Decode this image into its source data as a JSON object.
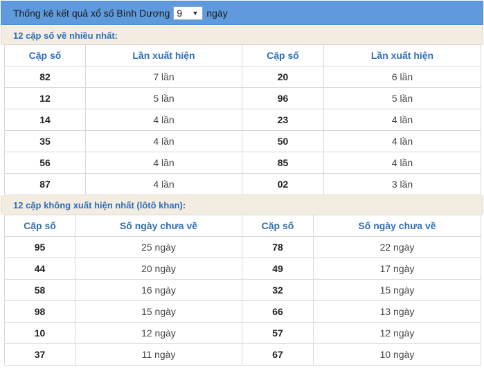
{
  "header": {
    "title": "Thống kê kết quả xổ số Bình Dương",
    "select_value": "9",
    "suffix": "ngày"
  },
  "most": {
    "label": "12 cặp số về nhiều nhất:",
    "columns": [
      "Cặp số",
      "Lần xuất hiện",
      "Cặp số",
      "Lần xuất hiện"
    ],
    "rows": [
      [
        "82",
        "7 lần",
        "20",
        "6 lần"
      ],
      [
        "12",
        "5 lần",
        "96",
        "5 lần"
      ],
      [
        "14",
        "4 lần",
        "23",
        "4 lần"
      ],
      [
        "35",
        "4 lần",
        "50",
        "4 lần"
      ],
      [
        "56",
        "4 lần",
        "85",
        "4 lần"
      ],
      [
        "87",
        "4 lần",
        "02",
        "3 lần"
      ]
    ]
  },
  "absent": {
    "label": "12 cặp không xuất hiện nhất (lôtô khan):",
    "columns": [
      "Cặp số",
      "Số ngày chưa về",
      "Cặp số",
      "Số ngày chưa về"
    ],
    "rows": [
      [
        "95",
        "25 ngày",
        "78",
        "22 ngày"
      ],
      [
        "44",
        "20 ngày",
        "49",
        "17 ngày"
      ],
      [
        "58",
        "16 ngày",
        "32",
        "15 ngày"
      ],
      [
        "98",
        "15 ngày",
        "66",
        "13 ngày"
      ],
      [
        "10",
        "12 ngày",
        "57",
        "12 ngày"
      ],
      [
        "37",
        "11 ngày",
        "67",
        "10 ngày"
      ]
    ]
  }
}
